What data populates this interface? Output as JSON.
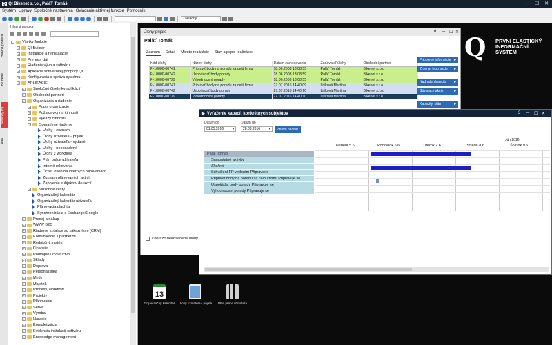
{
  "window": {
    "title": "QI Bikenet s.r.o., PaláT Tomáš",
    "logo_badge": "QI"
  },
  "menu": [
    "Systém",
    "Úpravy",
    "Spoločné nastavenia",
    "Ovládanie aktívnej funkcie",
    "Pomocník"
  ],
  "toolbar": {
    "combo": "Základný"
  },
  "vtabs": {
    "hlavna_ponuka": "Hlavná ponuka",
    "oblubene": "Obľúbené",
    "novinky": "Novinky (5)",
    "okno": "Okno"
  },
  "main_menu": {
    "title": "Hlavná ponuka",
    "tree": [
      "Všetky funkcie",
      "QI Builder",
      "Inštalácie a reinštalácie",
      "Prenosy dát",
      "Riadenie vývoja softvéru",
      "Aplikácie softvarovej podpory QI",
      "Konfigurácia a správa systému",
      "APLIKÁCIE",
      "Spoločné číselníky aplikácií",
      "Obchodní partneri",
      "Organizácia a riadenie",
      "Popis organizácie",
      "Požiadavky na činnosti",
      "Výkazy činností",
      "Operatívne riadenie",
      "Úlohy - zoznam",
      "Úlohy užívateľa - prijaté",
      "Úlohy užívateľa - vydané",
      "Úlohy - neobsadené",
      "Úlohy z workflow",
      "Plán práce užívateľa",
      "Interné rokovania",
      "Účasť osôb na interných rokovaniach",
      "Zoznam plánovaných aktivít",
      "Zapojenie subjektov do akcií",
      "Služobné cesty",
      "Organizačný kalendár",
      "Organizačný kalendár užívateľa",
      "Plánovacia plachta",
      "Synchronizácia s Exchange/Google",
      "Predaj a nákup",
      "WWW B2B",
      "Riadenie vzťahov so zákazníkmi (CRM)",
      "Komunikácia s partnermi",
      "Redakčný systém",
      "Financie",
      "Podvojné účtovníctvo",
      "Sklady",
      "Doprava",
      "Personalistika",
      "Mzdy",
      "Majetok",
      "Procesy, workflow",
      "Projekty",
      "Plánovanie",
      "Servis",
      "Výroba",
      "Náradie",
      "Kompletizácia",
      "Evidencia inštalácií softvéru",
      "Knowledge management"
    ]
  },
  "logo": {
    "mark": "Q",
    "line1": "PRVNÍ ELASTICKÝ",
    "line2": "INFORMAČNÍ",
    "line3": "SYSTÉM"
  },
  "ulohy": {
    "window_title": "Úlohy prijaté",
    "controls": {
      "pin": "6",
      "min": "─",
      "max": "☐",
      "close": "✕"
    },
    "subtitle": "Paláť Tomáš",
    "tabs": [
      "Zoznam",
      "Detail",
      "Miesto realizácie",
      "Stav a popis realizácie"
    ],
    "columns": [
      "Kód úlohy",
      "Názov úlohy",
      "Dátum zaevidovania",
      "Zadávateľ úlohy",
      "Obchodní partner"
    ],
    "rows": [
      {
        "kod": "P-10000-00741",
        "nazov": "Pripraviť body na poradu za celú firmu",
        "datum": "18.06.2008 13:08:55",
        "zadavatel": "Paláť Tomáš",
        "partner": "Bikenet s.r.o.",
        "style": "r-green"
      },
      {
        "kod": "P-10000-00742",
        "nazov": "Usporiadať body porady",
        "datum": "18.06.2008 13:08:59",
        "zadavatel": "Paláť Tomáš",
        "partner": "Bikenet s.r.o.",
        "style": "r-green"
      },
      {
        "kod": "P-10000-00739",
        "nazov": "Vyhodnocení porady",
        "datum": "18.06.2008 13:08:55",
        "zadavatel": "Paláť Tomáš",
        "partner": "Bikenet s.r.o.",
        "style": "r-green"
      },
      {
        "kod": "P-10000-00741",
        "nazov": "Pripraviť body na poradu za celú firmu",
        "datum": "27.07.2016 14:40:09",
        "zadavatel": "Lišková Martina",
        "partner": "Bikenet s.r.o.",
        "style": "r-blue"
      },
      {
        "kod": "P-10000-00742",
        "nazov": "Usporiadať body porady",
        "datum": "27.07.2016 14:40:10",
        "zadavatel": "Lišková Martina",
        "partner": "Bikenet s.r.o.",
        "style": "r-blue"
      },
      {
        "kod": "P-10000-00739",
        "nazov": "Vyhodnocení porady",
        "datum": "27.07.2016 14:40:10",
        "zadavatel": "Lišková Martina",
        "partner": "Bikenet s.r.o.",
        "style": "r-sel"
      }
    ],
    "actions": [
      "Pripojené informácie",
      "Zmena: typu akcie",
      "Nadradená akcia",
      "Súvisiace akcie",
      "Kapacity, plán"
    ],
    "checkbox": "Zobraziť neobsadené úlohy"
  },
  "vytazenie": {
    "window_title": "Vyťaženie kapacít konkrétnych subjektov",
    "controls": {
      "pin": "3",
      "min": "─",
      "max": "☐",
      "close": "✕"
    },
    "date_from_label": "Dátum od",
    "date_from": "01.05.2016",
    "date_to_label": "Dátum do",
    "date_to": "28.08.2016",
    "refresh_button": "Znovu načítať",
    "month": "Jún 2016",
    "days": [
      "Nedeľa 5.6.",
      "Pondelok 6.6.",
      "Utorok 7.6.",
      "Streda 8.6.",
      "Štvrtok 9.6."
    ],
    "rows": [
      {
        "label": "Paláť Tomáš",
        "kind": "person"
      },
      {
        "label": "Samostatné aktivity",
        "kind": "sub"
      },
      {
        "label": "Školení",
        "kind": "sub"
      },
      {
        "label": "Schválení FP vedením Připraveno",
        "kind": "sub"
      },
      {
        "label": "Připravit body na poradu za celou firmu Připravuje se",
        "kind": "sub"
      },
      {
        "label": "Uspořádat body porady Připravuje se",
        "kind": "sub"
      },
      {
        "label": "Vyhodnocení porady Připravuje se",
        "kind": "sub"
      }
    ]
  },
  "desktop_icons": [
    {
      "label": "Organizačný kalendár",
      "day": "13",
      "icon": "calendar-icon"
    },
    {
      "label": "Úlohy užívateľa - prijaté",
      "icon": "tasks-icon"
    },
    {
      "label": "Plán práce užívateľa",
      "icon": "plan-icon"
    }
  ],
  "colors": {
    "accent_blue": "#2d6ab4",
    "selected_row": "#1b3a5c",
    "green_row": "#c9ee8c",
    "gantt_bar": "#1e1ec8",
    "gantt_row": "#b6dbe4"
  }
}
